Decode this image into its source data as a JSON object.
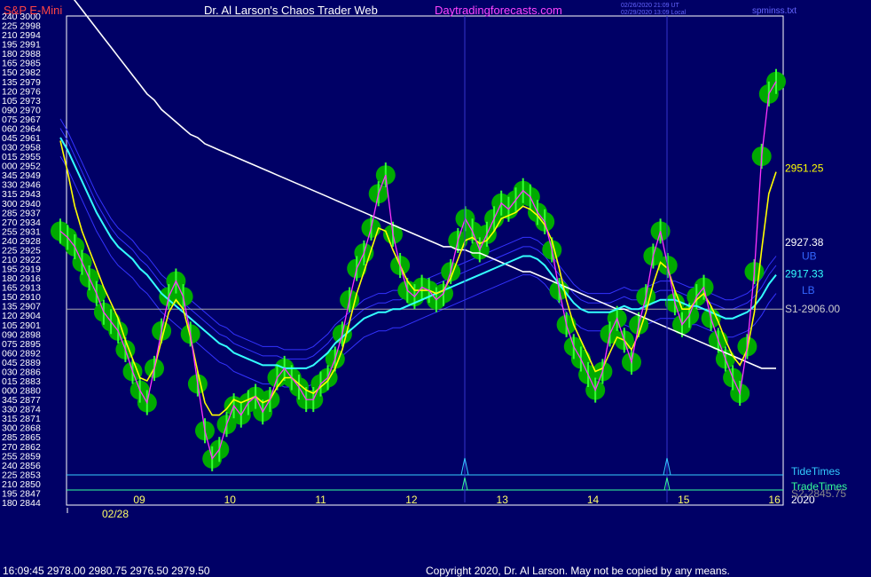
{
  "header": {
    "symbol": "S&P E-Mini",
    "title": "Dr. Al Larson's Chaos Trader Web",
    "site": "Daytradingforecasts.com",
    "time_line1": "02/26/2020 21:09 UT",
    "time_line2": "02/29/2020 13:09 Local",
    "file": "spminss.txt"
  },
  "footer": {
    "ohlc": "16:09:45  2978.00 2980.75 2976.50 2979.50",
    "copyright": "Copyright 2020, Dr. Al Larson. May not be copied by any means."
  },
  "colors": {
    "background": "#000066",
    "price": "#33ff33",
    "dots": "#00aa00",
    "fast_ma": "#ffff00",
    "mid_ma": "#ff33ff",
    "slow_ma": "#33ffff",
    "long_ma": "#ffffff",
    "band": "#3333ff",
    "tide": "#33ccff",
    "trade": "#33ff99"
  },
  "chart_data": {
    "type": "line",
    "ylim": [
      2844,
      3000
    ],
    "left_axis_labels": [
      "240 3000",
      "225 2998",
      "210 2994",
      "195 2991",
      "180 2988",
      "165 2985",
      "150 2982",
      "135 2979",
      "120 2976",
      "105 2973",
      "090 2970",
      "075 2967",
      "060 2964",
      "045 2961",
      "030 2958",
      "015 2955",
      "000 2952",
      "345 2949",
      "330 2946",
      "315 2943",
      "300 2940",
      "285 2937",
      "270 2934",
      "255 2931",
      "240 2928",
      "225 2925",
      "210 2922",
      "195 2919",
      "180 2916",
      "165 2913",
      "150 2910",
      "135 2907",
      "120 2904",
      "105 2901",
      "090 2898",
      "075 2895",
      "060 2892",
      "045 2889",
      "030 2886",
      "015 2883",
      "000 2880",
      "345 2877",
      "330 2874",
      "315 2871",
      "300 2868",
      "285 2865",
      "270 2862",
      "255 2859",
      "240 2856",
      "225 2853",
      "210 2850",
      "195 2847",
      "180 2844"
    ],
    "x_day_labels": [
      "09",
      "10",
      "11",
      "12",
      "13",
      "14",
      "15",
      "16"
    ],
    "x_date_label": "02/28",
    "year_label": "2020",
    "price_series": [
      2931,
      2929,
      2926,
      2921,
      2916,
      2911,
      2905,
      2902,
      2899,
      2893,
      2886,
      2880,
      2876,
      2887,
      2899,
      2910,
      2915,
      2910,
      2898,
      2882,
      2867,
      2858,
      2861,
      2869,
      2875,
      2872,
      2876,
      2878,
      2873,
      2877,
      2884,
      2887,
      2884,
      2881,
      2877,
      2877,
      2882,
      2884,
      2890,
      2898,
      2909,
      2919,
      2924,
      2932,
      2943,
      2949,
      2930,
      2920,
      2912,
      2910,
      2913,
      2912,
      2909,
      2911,
      2918,
      2928,
      2935,
      2931,
      2925,
      2930,
      2935,
      2940,
      2938,
      2941,
      2944,
      2942,
      2937,
      2934,
      2925,
      2912,
      2901,
      2894,
      2890,
      2885,
      2880,
      2886,
      2898,
      2903,
      2896,
      2889,
      2901,
      2910,
      2923,
      2931,
      2920,
      2908,
      2901,
      2904,
      2910,
      2913,
      2903,
      2896,
      2890,
      2884,
      2879,
      2894,
      2918,
      2955,
      2975,
      2979
    ],
    "fast_ma": [
      2960,
      2950,
      2939,
      2931,
      2925,
      2919,
      2913,
      2908,
      2903,
      2896,
      2890,
      2884,
      2883,
      2887,
      2896,
      2905,
      2909,
      2906,
      2897,
      2886,
      2876,
      2872,
      2872,
      2874,
      2877,
      2876,
      2877,
      2878,
      2876,
      2877,
      2881,
      2884,
      2884,
      2882,
      2880,
      2879,
      2881,
      2883,
      2887,
      2893,
      2902,
      2911,
      2918,
      2925,
      2932,
      2931,
      2925,
      2920,
      2915,
      2912,
      2912,
      2912,
      2911,
      2912,
      2916,
      2922,
      2928,
      2929,
      2927,
      2928,
      2931,
      2935,
      2936,
      2937,
      2939,
      2938,
      2936,
      2933,
      2928,
      2919,
      2909,
      2901,
      2896,
      2891,
      2886,
      2887,
      2892,
      2897,
      2896,
      2893,
      2898,
      2905,
      2914,
      2921,
      2919,
      2912,
      2906,
      2906,
      2909,
      2911,
      2907,
      2902,
      2896,
      2891,
      2888,
      2893,
      2905,
      2925,
      2943,
      2950
    ],
    "slow_ma": [
      2961,
      2957,
      2952,
      2947,
      2942,
      2937,
      2933,
      2929,
      2926,
      2924,
      2922,
      2919,
      2917,
      2914,
      2911,
      2909,
      2907,
      2905,
      2903,
      2901,
      2899,
      2897,
      2895,
      2894,
      2892,
      2891,
      2890,
      2889,
      2888,
      2888,
      2888,
      2887,
      2887,
      2887,
      2887,
      2888,
      2890,
      2892,
      2895,
      2897,
      2899,
      2901,
      2903,
      2904,
      2905,
      2905,
      2906,
      2906,
      2907,
      2908,
      2909,
      2910,
      2911,
      2912,
      2913,
      2914,
      2915,
      2916,
      2917,
      2918,
      2919,
      2920,
      2921,
      2922,
      2923,
      2923,
      2922,
      2920,
      2917,
      2914,
      2911,
      2908,
      2906,
      2905,
      2905,
      2905,
      2905,
      2906,
      2907,
      2906,
      2906,
      2907,
      2908,
      2909,
      2909,
      2909,
      2908,
      2907,
      2907,
      2906,
      2905,
      2904,
      2903,
      2903,
      2904,
      2905,
      2907,
      2910,
      2914,
      2917
    ],
    "long_ma": [
      3010,
      3008,
      3005,
      3002,
      2999,
      2996,
      2993,
      2990,
      2987,
      2984,
      2981,
      2978,
      2975,
      2973,
      2970,
      2968,
      2966,
      2964,
      2962,
      2961,
      2959,
      2958,
      2957,
      2956,
      2955,
      2954,
      2953,
      2952,
      2951,
      2950,
      2949,
      2948,
      2947,
      2946,
      2945,
      2944,
      2943,
      2942,
      2941,
      2940,
      2939,
      2938,
      2937,
      2936,
      2935,
      2934,
      2933,
      2932,
      2931,
      2930,
      2929,
      2928,
      2927,
      2926,
      2926,
      2925,
      2925,
      2924,
      2924,
      2923,
      2922,
      2921,
      2920,
      2919,
      2918,
      2918,
      2917,
      2916,
      2915,
      2914,
      2913,
      2912,
      2911,
      2910,
      2909,
      2908,
      2907,
      2906,
      2906,
      2905,
      2904,
      2903,
      2902,
      2901,
      2900,
      2899,
      2898,
      2897,
      2896,
      2895,
      2894,
      2893,
      2892,
      2891,
      2890,
      2889,
      2888,
      2887,
      2887,
      2887
    ],
    "price_labels": [
      {
        "text": "2951.25",
        "value": 2951.25,
        "color": "#ffff00"
      },
      {
        "text": "2927.38",
        "value": 2927.38,
        "color": "#ffffff"
      },
      {
        "text": "UB",
        "value": 2923,
        "color": "#3366ff"
      },
      {
        "text": "2917.33",
        "value": 2917.33,
        "color": "#33ffff"
      },
      {
        "text": "LB",
        "value": 2912,
        "color": "#3366ff"
      },
      {
        "text": "S1-2906.00",
        "value": 2906.0,
        "color": "#cccccc"
      }
    ],
    "support_line": 2906.0,
    "tide_label": "TideTimes",
    "trade_label": "TradeTimes",
    "bottom_price_label": "S2-2845.75"
  }
}
